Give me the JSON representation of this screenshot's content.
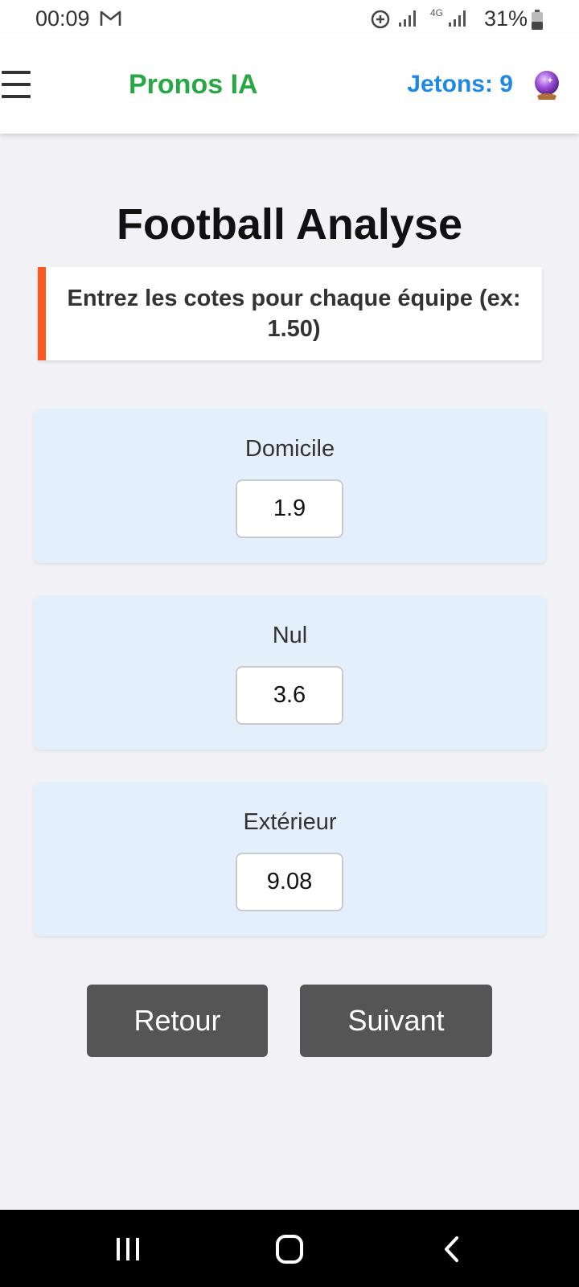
{
  "status_bar": {
    "time": "00:09",
    "network": "4G",
    "battery": "31%"
  },
  "header": {
    "title": "Pronos IA",
    "tokens_label": "Jetons: 9",
    "colors": {
      "title": "#28a745",
      "tokens": "#1e88e5"
    }
  },
  "main": {
    "title": "Football Analyse",
    "notice": "Entrez les cotes pour chaque équipe (ex: 1.50)",
    "accent_color": "#ff5722",
    "odds": [
      {
        "label": "Domicile",
        "value": "1.9"
      },
      {
        "label": "Nul",
        "value": "3.6"
      },
      {
        "label": "Extérieur",
        "value": "9.08"
      }
    ]
  },
  "buttons": {
    "back": "Retour",
    "next": "Suivant"
  },
  "icons": {
    "status": [
      "gmail-icon",
      "sync-icon",
      "signal-icon",
      "battery-icon"
    ],
    "header": [
      "menu-icon",
      "crystal-ball-icon"
    ],
    "nav": [
      "recent-apps-icon",
      "home-icon",
      "back-icon"
    ]
  }
}
